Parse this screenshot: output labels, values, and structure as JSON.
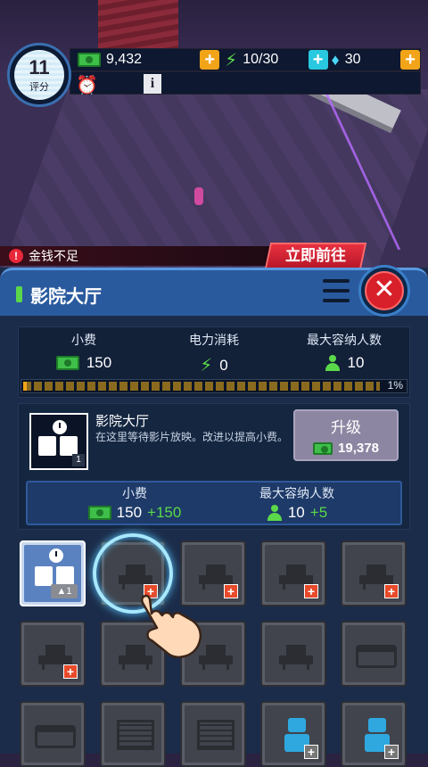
{
  "hud": {
    "rating_value": "11",
    "rating_label": "评分",
    "money": "9,432",
    "energy": "10/30",
    "diamonds": "30"
  },
  "alert": {
    "text": "金钱不足",
    "go_label": "立即前往"
  },
  "panel": {
    "title": "影院大厅",
    "stats": {
      "tips_label": "小费",
      "tips_value": "150",
      "power_label": "电力消耗",
      "power_value": "0",
      "capacity_label": "最大容纳人数",
      "capacity_value": "10",
      "progress_label": "1%",
      "progress_fraction": 0.01
    },
    "facility": {
      "name": "影院大厅",
      "description": "在这里等待影片放映。改进以提高小费。",
      "level": "1",
      "upgrade_label": "升级",
      "upgrade_cost": "19,378",
      "bonus_tips_label": "小费",
      "bonus_tips_value": "150",
      "bonus_tips_plus": "+150",
      "bonus_capacity_label": "最大容纳人数",
      "bonus_capacity_value": "10",
      "bonus_capacity_plus": "+5"
    },
    "slots": [
      {
        "kind": "selected-seat",
        "level": "1"
      },
      {
        "kind": "chair",
        "addable": true
      },
      {
        "kind": "chair",
        "addable": true
      },
      {
        "kind": "chair",
        "addable": true
      },
      {
        "kind": "chair",
        "addable": true
      },
      {
        "kind": "chair",
        "addable": true
      },
      {
        "kind": "chair",
        "addable": false
      },
      {
        "kind": "chair",
        "addable": false
      },
      {
        "kind": "chair",
        "addable": false
      },
      {
        "kind": "sofa",
        "addable": false
      },
      {
        "kind": "sofa",
        "addable": false
      },
      {
        "kind": "tv",
        "addable": false
      },
      {
        "kind": "tv",
        "addable": false
      },
      {
        "kind": "robot",
        "addable": true
      },
      {
        "kind": "robot",
        "addable": true
      }
    ]
  },
  "colors": {
    "panel_header": "#2a5a9e",
    "accent_orange": "#f2a418",
    "accent_green": "#5bd84a",
    "close_red": "#d8202a"
  }
}
